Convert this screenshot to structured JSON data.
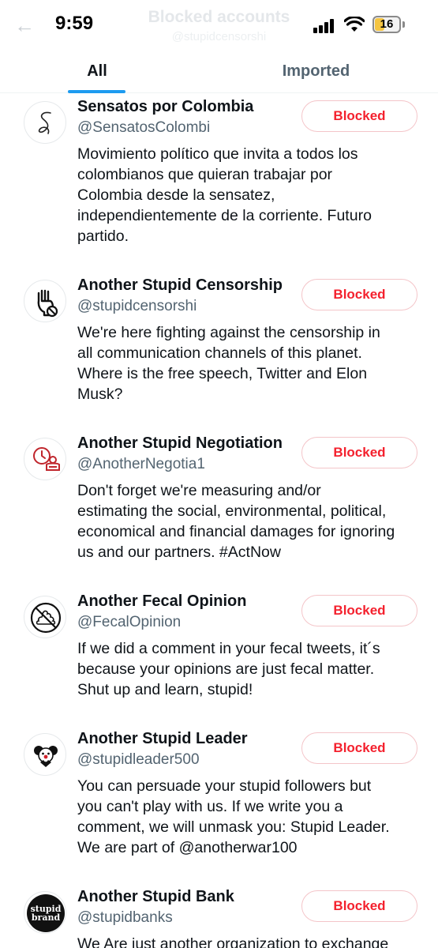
{
  "status_bar": {
    "time": "9:59",
    "battery": "16"
  },
  "header": {
    "title": "Blocked accounts",
    "subtitle": "@stupidcensorshi"
  },
  "tabs": [
    {
      "label": "All",
      "active": true
    },
    {
      "label": "Imported",
      "active": false
    }
  ],
  "accent_color": "#1d9bf0",
  "blocked_color": "#f4212e",
  "accounts": [
    {
      "name": "Sensatos por Colombia",
      "handle": "@SensatosColombi",
      "button": "Blocked",
      "avatar_icon": "signature-icon",
      "bio": [
        "Movimiento político que invita a todos los",
        "colombianos que quieran trabajar por",
        "Colombia desde la sensatez,",
        "independientemente de la corriente. Futuro",
        "partido."
      ]
    },
    {
      "name": "Another Stupid Censorship",
      "handle": "@stupidcensorshi",
      "button": "Blocked",
      "avatar_icon": "raised-fist-no-icon",
      "bio": [
        "We're here fighting against the censorship in",
        "all communication channels of this planet.",
        "Where is the free speech, Twitter and Elon",
        "Musk?"
      ]
    },
    {
      "name": "Another Stupid Negotiation",
      "handle": "@AnotherNegotia1",
      "button": "Blocked",
      "avatar_icon": "clock-person-icon",
      "bio": [
        "Don't forget we're measuring and/or",
        "estimating the social, environmental, political,",
        "economical and financial damages for ignoring",
        "us and our partners. #ActNow"
      ]
    },
    {
      "name": "Another Fecal Opinion",
      "handle": "@FecalOpinion",
      "button": "Blocked",
      "avatar_icon": "no-poop-icon",
      "bio": [
        "If we did a comment in your fecal tweets, it´s",
        "because your opinions are just fecal matter.",
        "Shut up and learn, stupid!"
      ]
    },
    {
      "name": "Another Stupid Leader",
      "handle": "@stupidleader500",
      "button": "Blocked",
      "avatar_icon": "clown-icon",
      "bio": [
        "You can persuade your stupid followers but",
        "you can't play with us. If we write you a",
        "comment, we will unmask you: Stupid Leader.",
        "We are part of @anotherwar100"
      ]
    },
    {
      "name": "Another Stupid Bank",
      "handle": "@stupidbanks",
      "button": "Blocked",
      "avatar_icon": "stupid-brand-logo",
      "avatar_text": [
        "stupid",
        "brand"
      ],
      "bio": [
        "We Are just another organization to exchange"
      ]
    }
  ]
}
